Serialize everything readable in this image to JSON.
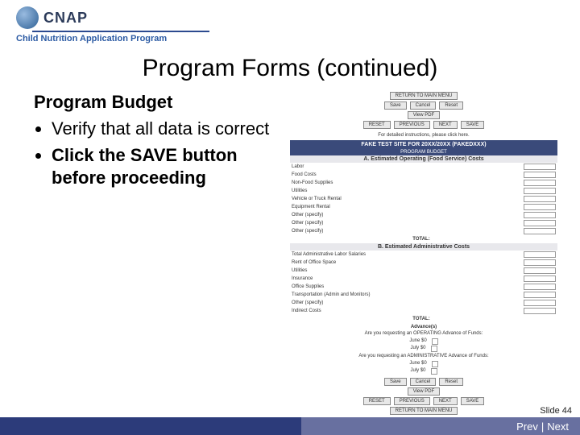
{
  "brand": {
    "abbr": "CNAP",
    "tagline": "Child Nutrition Application Program"
  },
  "title": "Program Forms (continued)",
  "body": {
    "subhead": "Program Budget",
    "bullet1": "Verify that all data is correct",
    "bullet2": "Click the SAVE button before proceeding"
  },
  "screenshot": {
    "return_btn": "RETURN TO MAIN MENU",
    "btn_save": "Save",
    "btn_cancel": "Cancel",
    "btn_reset": "Reset",
    "btn_view": "View PDF",
    "nav_reset": "RESET",
    "nav_prev": "PREVIOUS",
    "nav_next": "NEXT",
    "nav_save": "SAVE",
    "help": "For detailed instructions, please click here.",
    "banner": "FAKE TEST SITE FOR 20XX/20XX (FAKEDXXX)",
    "sub_banner": "PROGRAM BUDGET",
    "sectionA": "A. Estimated Operating (Food Service) Costs",
    "rowsA": [
      "Labor",
      "Food Costs",
      "Non-Food Supplies",
      "Utilities",
      "Vehicle or Truck Rental",
      "Equipment Rental",
      "Other (specify)",
      "Other (specify)",
      "Other (specify)"
    ],
    "totalA": "TOTAL:",
    "sectionB": "B. Estimated Administrative Costs",
    "rowsB": [
      "Total Administrative Labor Salaries",
      "Rent of Office Space",
      "Utilities",
      "Insurance",
      "Office Supplies",
      "Transportation (Admin and Monitors)",
      "Other (specify)",
      "Indirect Costs"
    ],
    "totalB": "TOTAL:",
    "advances": "Advance(s)",
    "adv_q1": "Are you requesting an OPERATING Advance of Funds:",
    "adv_q2": "Are you requesting an ADMINISTRATIVE Advance of Funds:",
    "adv_rows": [
      "June $0",
      "July $0",
      "June $0",
      "July $0"
    ]
  },
  "footer": {
    "slide": "Slide 44",
    "prev": "Prev",
    "sep": "|",
    "next": "Next"
  }
}
